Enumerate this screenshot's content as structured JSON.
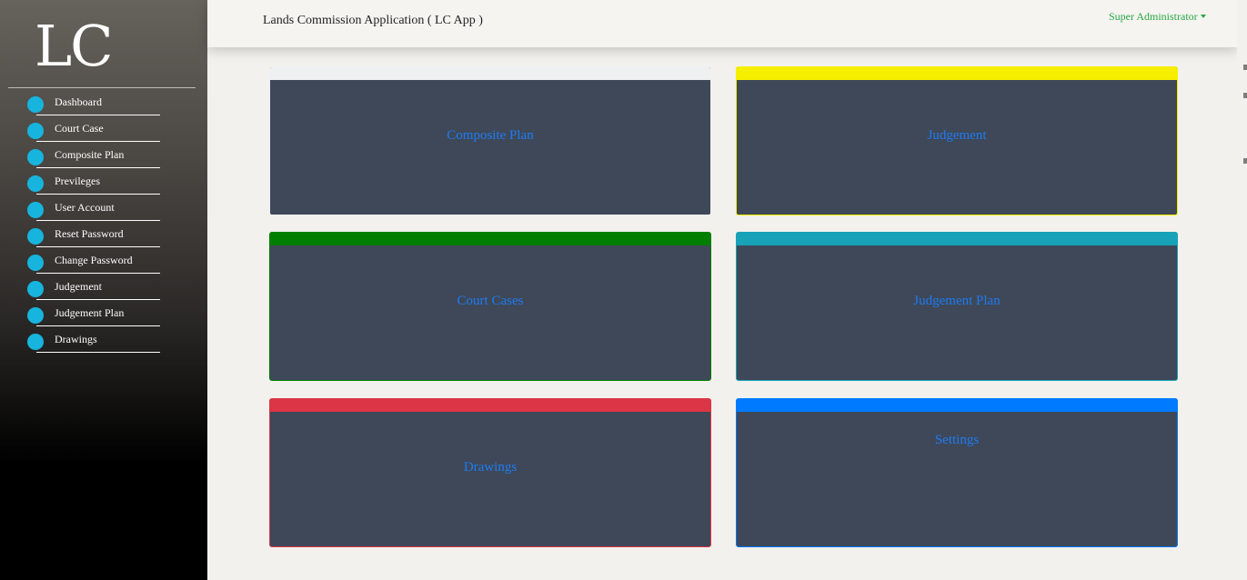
{
  "sidebar": {
    "logo": "LC",
    "items": [
      {
        "label": "Dashboard"
      },
      {
        "label": "Court Case"
      },
      {
        "label": "Composite Plan"
      },
      {
        "label": "Previleges"
      },
      {
        "label": "User Account"
      },
      {
        "label": "Reset Password"
      },
      {
        "label": "Change Password"
      },
      {
        "label": "Judgement"
      },
      {
        "label": "Judgement Plan"
      },
      {
        "label": "Drawings"
      }
    ]
  },
  "header": {
    "title": "Lands Commission Application ( LC App )",
    "user": "Super Administrator"
  },
  "cards": [
    {
      "title": "Composite Plan",
      "accent": "#eef0f2"
    },
    {
      "title": "Judgement",
      "accent": "#f6f000"
    },
    {
      "title": "Court Cases",
      "accent": "#007e00"
    },
    {
      "title": "Judgement Plan",
      "accent": "#17a2b8"
    },
    {
      "title": "Drawings",
      "accent": "#dc3545"
    },
    {
      "title": "Settings",
      "accent": "#007bff"
    }
  ],
  "colors": {
    "card_body": "#3e4858",
    "card_text": "#1f7bf2",
    "nav_dot": "#17b4de",
    "user_link": "#28a745"
  }
}
